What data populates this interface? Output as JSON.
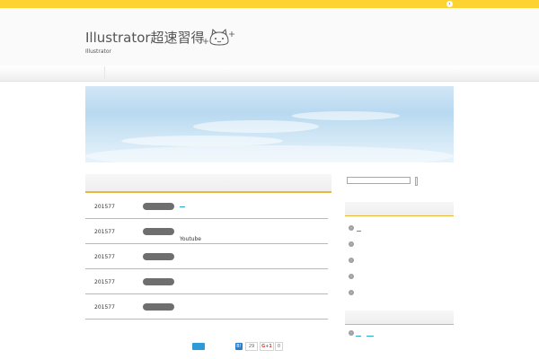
{
  "topbar": {
    "color": "#fdd331",
    "arrow_icon": "chevron-right-icon"
  },
  "site": {
    "title": "Illustrator超速習得",
    "subtitle": "Illustrator",
    "logo_icon": "cat-face-logo-icon"
  },
  "main": {
    "accent_color": "#e8b83a",
    "posts": [
      {
        "date": "201577",
        "text": ""
      },
      {
        "date": "201577",
        "text": "Youtube"
      },
      {
        "date": "201577",
        "text": ""
      },
      {
        "date": "201577",
        "text": ""
      },
      {
        "date": "201577",
        "text": ""
      }
    ]
  },
  "share": {
    "hatena_label": "B!",
    "hatena_count": "29",
    "gplus_label": "G+1",
    "gplus_count": "0"
  }
}
